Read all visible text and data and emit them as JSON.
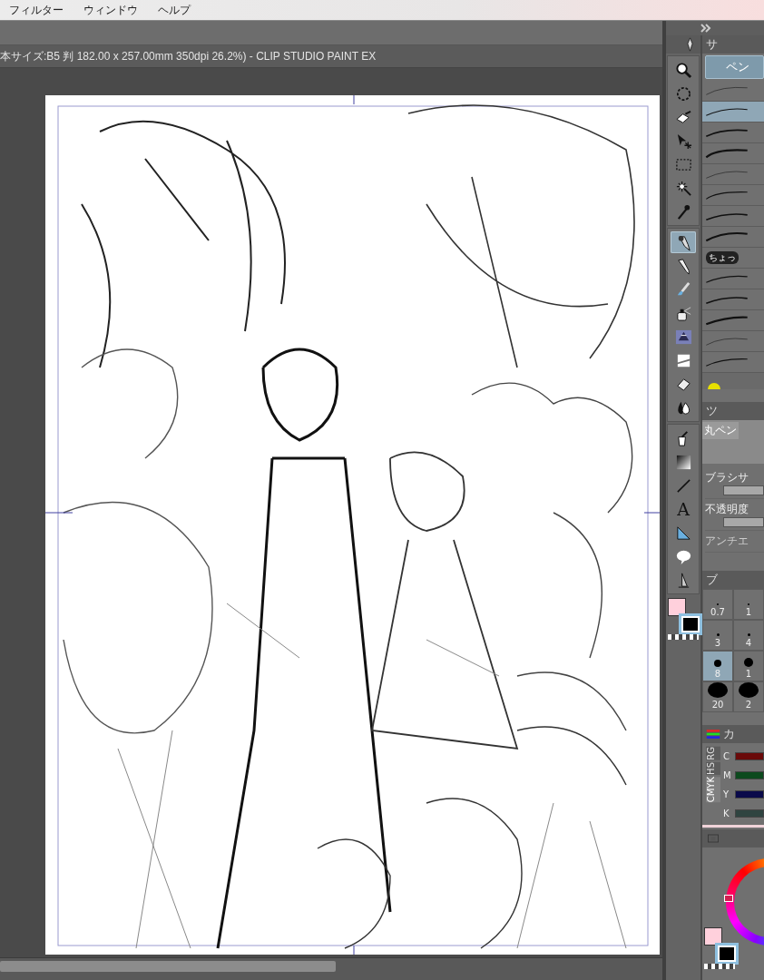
{
  "menu": [
    "フィルター",
    "ウィンドウ",
    "ヘルプ"
  ],
  "document_title": "本サイズ:B5 判 182.00 x 257.00mm 350dpi 26.2%)  - CLIP STUDIO PAINT EX",
  "canvas": {
    "kind": "picture"
  },
  "tool_groups": [
    [
      {
        "kind": "zoom",
        "selected": false
      },
      {
        "kind": "rotate",
        "selected": false
      },
      {
        "kind": "hand",
        "selected": false
      },
      {
        "kind": "object",
        "selected": false
      },
      {
        "kind": "marquee",
        "selected": false
      },
      {
        "kind": "wand",
        "selected": false
      },
      {
        "kind": "eyedropper",
        "selected": false
      }
    ],
    [
      {
        "kind": "pen",
        "selected": true
      },
      {
        "kind": "pencil",
        "selected": false
      },
      {
        "kind": "brush",
        "selected": false
      },
      {
        "kind": "airbrush",
        "selected": false
      },
      {
        "kind": "decoration",
        "selected": false
      },
      {
        "kind": "blend",
        "selected": false
      },
      {
        "kind": "eraser",
        "selected": false
      },
      {
        "kind": "drop",
        "selected": false
      }
    ],
    [
      {
        "kind": "fill",
        "selected": false
      },
      {
        "kind": "gradient",
        "selected": false
      },
      {
        "kind": "line",
        "selected": false
      },
      {
        "kind": "text",
        "label": "A",
        "selected": false
      },
      {
        "kind": "ruler",
        "selected": false
      },
      {
        "kind": "balloon",
        "selected": false
      },
      {
        "kind": "correction",
        "selected": false
      }
    ]
  ],
  "tool_colors": [
    {
      "color": "#ffd0dc",
      "selected": false
    },
    {
      "color": "#000000",
      "selected": true
    }
  ],
  "subtool": {
    "title": "サ",
    "tab": "ペン",
    "brushes": [
      {
        "selected": false
      },
      {
        "selected": true
      },
      {
        "selected": false
      },
      {
        "selected": false
      },
      {
        "selected": false
      },
      {
        "selected": false
      },
      {
        "selected": false
      },
      {
        "selected": false
      },
      {
        "label": "ちょっ",
        "selected": false
      },
      {
        "selected": false
      },
      {
        "selected": false
      },
      {
        "selected": false
      },
      {
        "selected": false
      },
      {
        "selected": false
      }
    ]
  },
  "tool_property": {
    "title": "ツ",
    "name": "丸ペン",
    "fields": [
      {
        "kind": "slider",
        "label": "ブラシサ",
        "level": 1
      },
      {
        "kind": "slider",
        "label": "不透明度",
        "level": 1
      },
      {
        "kind": "plain",
        "label": "アンチエ"
      }
    ]
  },
  "brush_size": {
    "title": "ブ",
    "sizes": [
      {
        "label": "0.7",
        "selected": false
      },
      {
        "label": "1",
        "selected": false
      },
      {
        "label": "3",
        "selected": false
      },
      {
        "label": "4",
        "selected": false
      },
      {
        "label": "8",
        "selected": true
      },
      {
        "label": "1",
        "selected": false
      },
      {
        "label": "20",
        "selected": false
      },
      {
        "label": "2",
        "selected": false
      }
    ]
  },
  "color_slider": {
    "title": "カ",
    "tabs": [
      {
        "label": "RG",
        "selected": false
      },
      {
        "label": "HS",
        "selected": false
      },
      {
        "label": "CMYK",
        "selected": true
      }
    ],
    "channels": [
      {
        "label": "C",
        "color": "#6a0a0a"
      },
      {
        "label": "M",
        "color": "#0d4a1e"
      },
      {
        "label": "Y",
        "color": "#0a0a4a"
      },
      {
        "label": "K",
        "color": "#2f4440"
      }
    ]
  },
  "color_wheel": {
    "colors": [
      {
        "color": "#ffd0dc",
        "selected": false
      },
      {
        "color": "#000000",
        "selected": true
      }
    ]
  }
}
